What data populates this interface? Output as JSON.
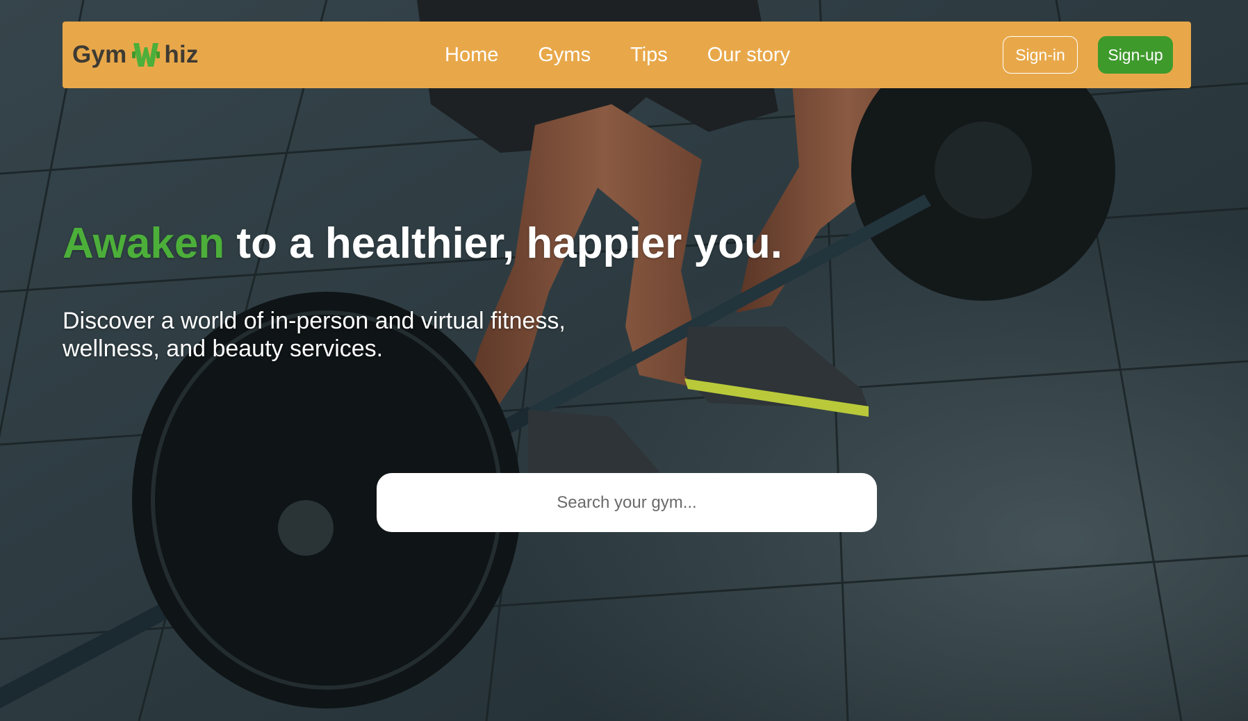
{
  "brand": {
    "name_left": "Gym",
    "name_right": "hiz",
    "mark_color": "#4caf3a"
  },
  "nav": {
    "links": [
      "Home",
      "Gyms",
      "Tips",
      "Our story"
    ],
    "signin_label": "Sign-in",
    "signup_label": "Sign-up"
  },
  "hero": {
    "headline_accent": "Awaken",
    "headline_rest": " to a healthier, happier you.",
    "subtext_line1": "Discover a world of in-person and virtual fitness,",
    "subtext_line2": "wellness, and beauty services."
  },
  "search": {
    "placeholder": "Search your gym...",
    "value": ""
  },
  "colors": {
    "navbar_bg": "#e8a84a",
    "accent_green": "#4caf3a",
    "signup_bg": "#3f9a2c"
  }
}
